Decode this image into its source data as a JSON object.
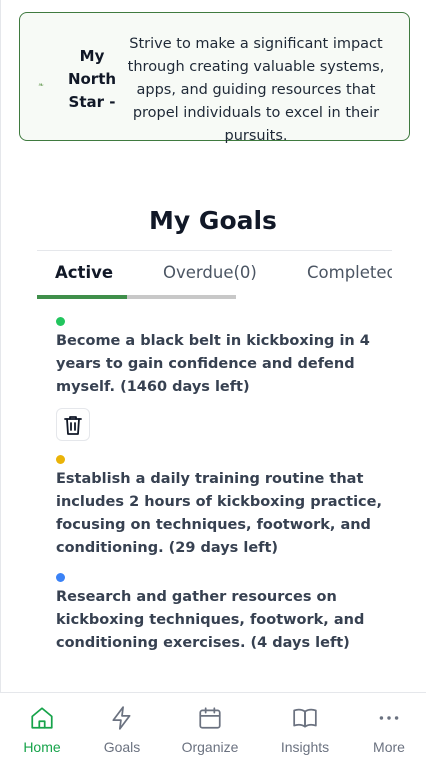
{
  "north_star": {
    "label": "My North Star -",
    "text": "Strive to make a significant impact through creating valuable systems, apps, and guiding resources that propel individuals to excel in their pursuits."
  },
  "goals_title": "My Goals",
  "tabs": [
    {
      "label": "Active",
      "selected": true
    },
    {
      "label": "Overdue(0)",
      "selected": false
    },
    {
      "label": "Completed",
      "selected": false
    }
  ],
  "goals": [
    {
      "color": "#22c55e",
      "text": "Become a black belt in kickboxing in 4 years to gain confidence and defend myself. (1460 days left)"
    },
    {
      "color": "#eab308",
      "text": "Establish a daily training routine that includes 2 hours of kickboxing practice, focusing on techniques, footwork, and conditioning. (29 days left)"
    },
    {
      "color": "#3b82f6",
      "text": "Research and gather resources on kickboxing techniques, footwork, and conditioning exercises. (4 days left)"
    }
  ],
  "nav": [
    {
      "label": "Home",
      "icon": "home-icon",
      "active": true
    },
    {
      "label": "Goals",
      "icon": "lightning-icon",
      "active": false
    },
    {
      "label": "Organize",
      "icon": "calendar-icon",
      "active": false
    },
    {
      "label": "Insights",
      "icon": "book-icon",
      "active": false
    },
    {
      "label": "More",
      "icon": "more-icon",
      "active": false
    }
  ],
  "colors": {
    "accent": "#16a34a",
    "border": "#3f7a3f"
  }
}
